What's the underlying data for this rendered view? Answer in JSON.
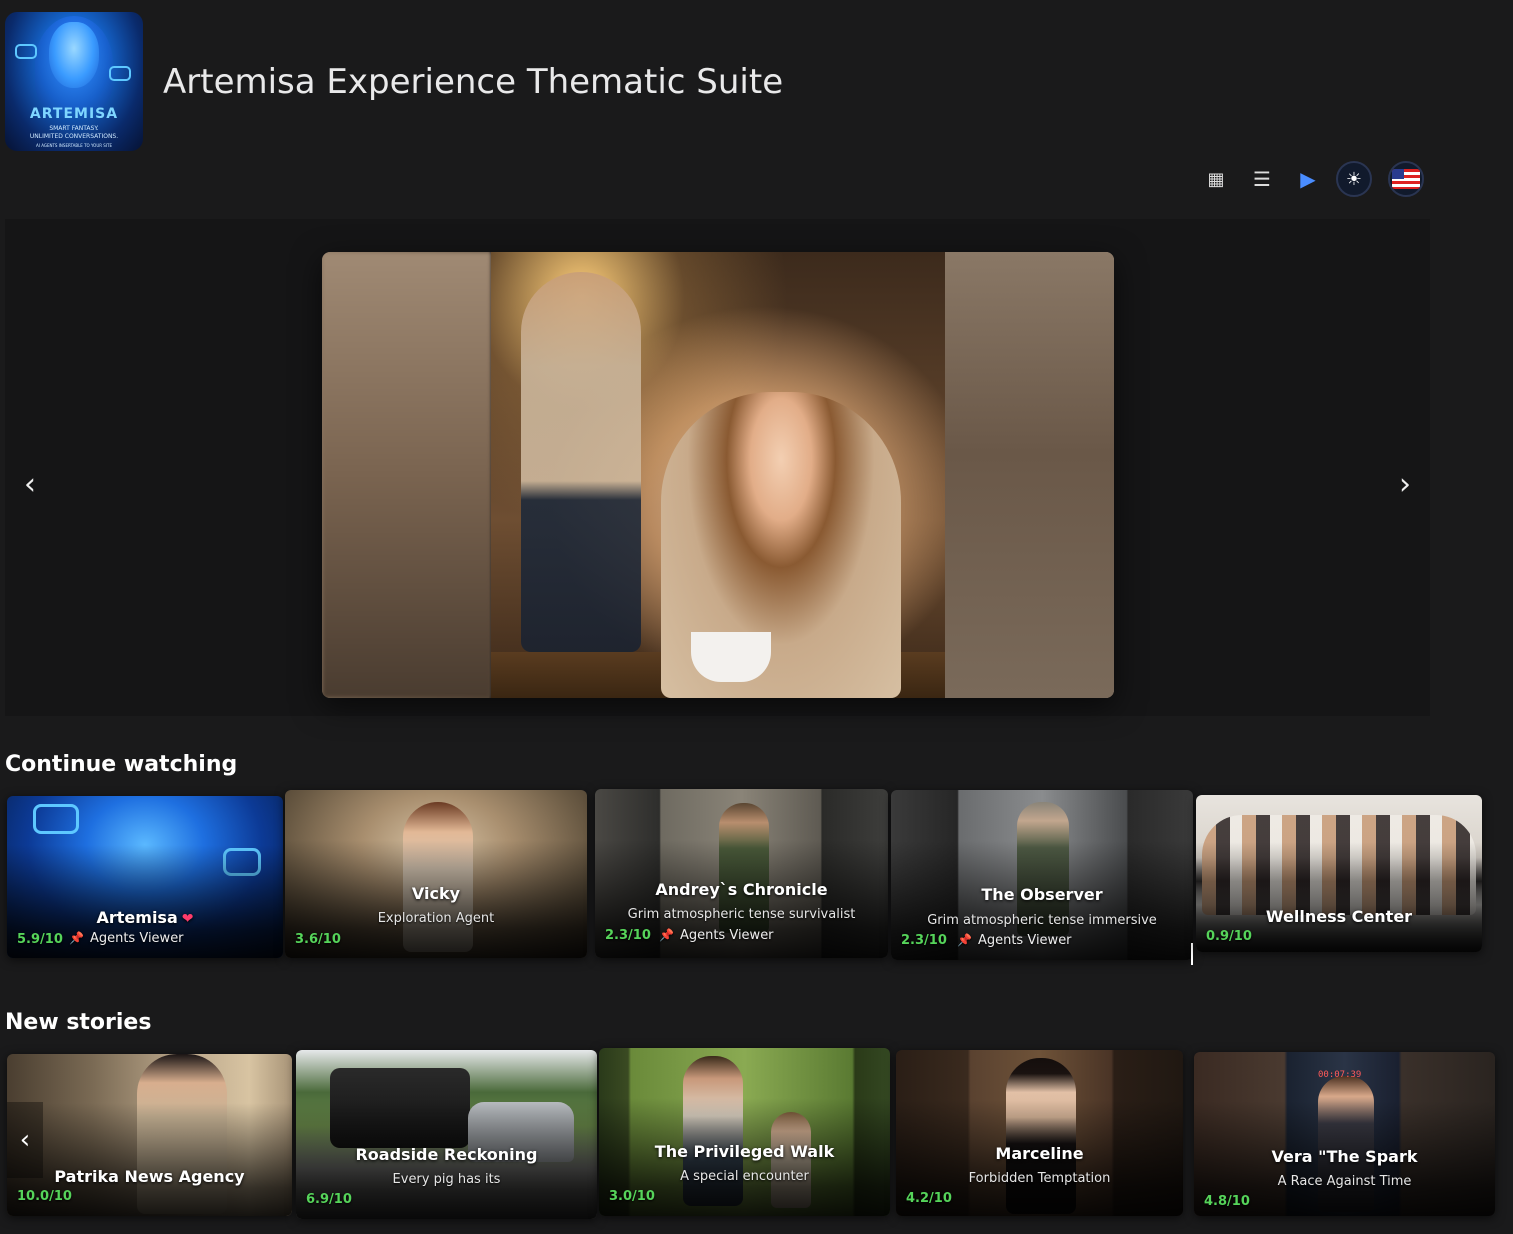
{
  "app": {
    "title": "Artemisa Experience Thematic Suite",
    "logo": {
      "brand": "ARTEMISA",
      "tagline1": "SMART FANTASY.",
      "tagline2": "UNLIMITED CONVERSATIONS.",
      "tagline3": "AI AGENTS INSERTABLE TO YOUR SITE"
    }
  },
  "toolbar": {
    "grid_icon": "▦",
    "list_icon": "☰",
    "play_icon": "▶",
    "theme_icon": "☀",
    "language_icon": "us-flag"
  },
  "hero": {
    "prev": "‹",
    "next": "›"
  },
  "continue_watching": {
    "title": "Continue watching",
    "cards": [
      {
        "title": "Artemisa",
        "subtitle": "",
        "rating": "5.9/10",
        "viewer": "Agents Viewer",
        "has_heart": true
      },
      {
        "title": "Vicky",
        "subtitle": "Exploration Agent",
        "rating": "3.6/10",
        "viewer": ""
      },
      {
        "title": "Andrey`s Chronicle",
        "subtitle": "Grim atmospheric tense survivalist",
        "rating": "2.3/10",
        "viewer": "Agents Viewer"
      },
      {
        "title": "The Observer",
        "subtitle": "Grim atmospheric tense immersive",
        "rating": "2.3/10",
        "viewer": "Agents Viewer"
      },
      {
        "title": "Wellness Center",
        "subtitle": "",
        "rating": "0.9/10",
        "viewer": ""
      }
    ]
  },
  "new_stories": {
    "title": "New stories",
    "prev": "‹",
    "cards": [
      {
        "title": "Patrika News Agency",
        "subtitle": "",
        "rating": "10.0/10"
      },
      {
        "title": "Roadside Reckoning",
        "subtitle": "Every pig has its",
        "rating": "6.9/10"
      },
      {
        "title": "The Privileged Walk",
        "subtitle": "A special encounter",
        "rating": "3.0/10"
      },
      {
        "title": "Marceline",
        "subtitle": "Forbidden Temptation",
        "rating": "4.2/10"
      },
      {
        "title": "Vera \"The Spark",
        "subtitle": "A Race Against Time",
        "rating": "4.8/10"
      }
    ]
  }
}
